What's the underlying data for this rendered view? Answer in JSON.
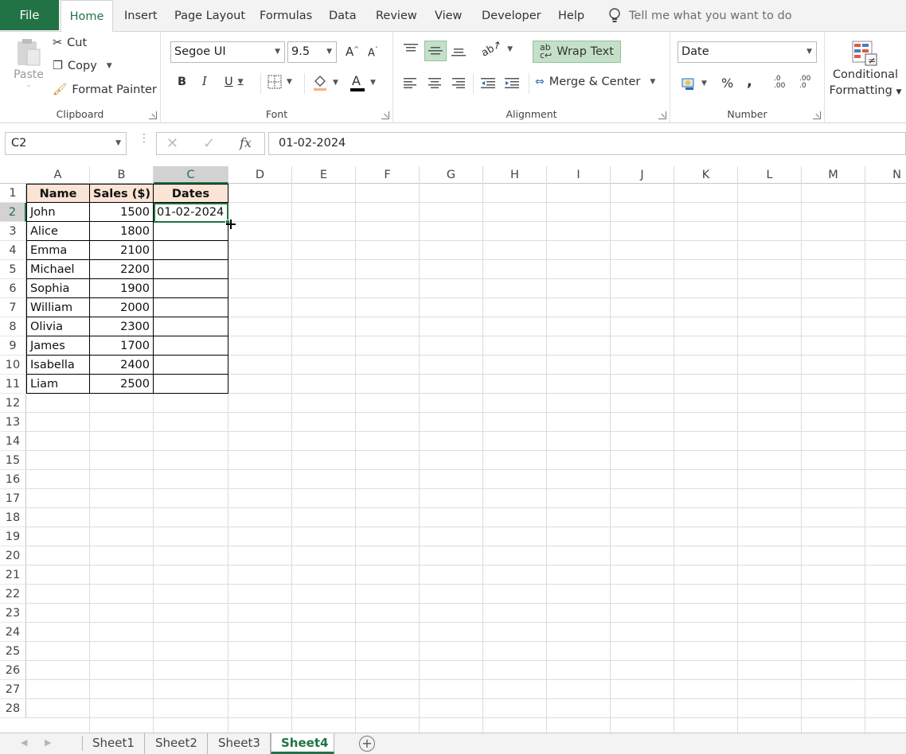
{
  "tabs": {
    "file": "File",
    "items": [
      "Home",
      "Insert",
      "Page Layout",
      "Formulas",
      "Data",
      "Review",
      "View",
      "Developer",
      "Help"
    ],
    "tell_me": "Tell me what you want to do"
  },
  "ribbon": {
    "clipboard": {
      "paste": "Paste",
      "cut": "Cut",
      "copy": "Copy",
      "format_painter": "Format Painter",
      "label": "Clipboard"
    },
    "font": {
      "family": "Segoe UI",
      "size": "9.5",
      "label": "Font",
      "bold": "B",
      "italic": "I",
      "underline": "U"
    },
    "alignment": {
      "wrap_text": "Wrap Text",
      "merge_center": "Merge & Center",
      "label": "Alignment"
    },
    "number": {
      "format": "Date",
      "percent": "%",
      "comma": ",",
      "label": "Number",
      "inc_dec": ".0\n.00",
      "dec_dec": ".00\n.0"
    },
    "styles": {
      "conditional_line1": "Conditional",
      "conditional_line2": "Formatting"
    }
  },
  "formula_bar": {
    "name_box": "C2",
    "fx": "fx",
    "formula": "01-02-2024"
  },
  "columns": [
    "A",
    "B",
    "C",
    "D",
    "E",
    "F",
    "G",
    "H",
    "I",
    "J",
    "K",
    "L",
    "M",
    "N"
  ],
  "selected_column": "C",
  "selected_row": 2,
  "rows": [
    "1",
    "2",
    "3",
    "4",
    "5",
    "6",
    "7",
    "8",
    "9",
    "10",
    "11",
    "12",
    "13",
    "14",
    "15",
    "16",
    "17",
    "18",
    "19",
    "20",
    "21",
    "22",
    "23",
    "24",
    "25",
    "26",
    "27",
    "28"
  ],
  "table": {
    "headers": [
      "Name",
      "Sales ($)",
      "Dates"
    ],
    "data": [
      [
        "John",
        "1500",
        "01-02-2024"
      ],
      [
        "Alice",
        "1800",
        ""
      ],
      [
        "Emma",
        "2100",
        ""
      ],
      [
        "Michael",
        "2200",
        ""
      ],
      [
        "Sophia",
        "1900",
        ""
      ],
      [
        "William",
        "2000",
        ""
      ],
      [
        "Olivia",
        "2300",
        ""
      ],
      [
        "James",
        "1700",
        ""
      ],
      [
        "Isabella",
        "2400",
        ""
      ],
      [
        "Liam",
        "2500",
        ""
      ]
    ]
  },
  "sheets": [
    "Sheet1",
    "Sheet2",
    "Sheet3",
    "Sheet4"
  ],
  "active_sheet": "Sheet4",
  "colors": {
    "accent": "#217346",
    "header_fill": "#fbe3d6"
  }
}
